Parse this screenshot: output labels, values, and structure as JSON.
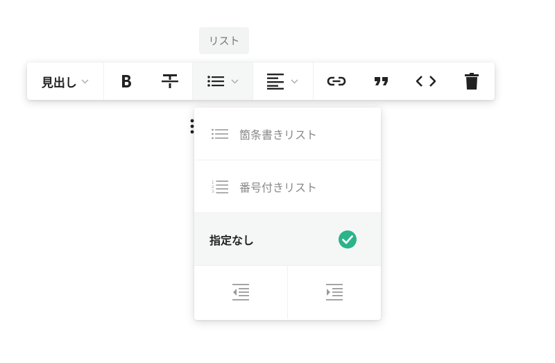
{
  "tooltip": {
    "text": "リスト"
  },
  "toolbar": {
    "heading_label": "見出し",
    "icons": [
      "chevron-down-icon",
      "bold-icon",
      "strikethrough-icon",
      "bullet-list-icon",
      "align-left-icon",
      "link-icon",
      "quote-icon",
      "code-icon",
      "trash-icon"
    ]
  },
  "list_menu": {
    "items": [
      {
        "label": "箇条書きリスト",
        "icon": "bullet-list-icon",
        "selected": false
      },
      {
        "label": "番号付きリスト",
        "icon": "numbered-list-icon",
        "selected": false
      },
      {
        "label": "指定なし",
        "icon": "",
        "selected": true
      }
    ],
    "indent_actions": [
      "outdent-icon",
      "indent-icon"
    ]
  },
  "colors": {
    "accent_check": "#2bb38a",
    "icon_dark": "#222222",
    "icon_muted": "#9a9a9a"
  }
}
